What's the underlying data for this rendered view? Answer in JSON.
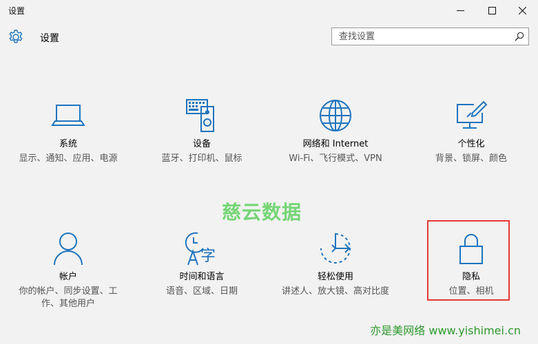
{
  "window": {
    "title": "设置"
  },
  "header": {
    "title": "设置"
  },
  "search": {
    "placeholder": "查找设置"
  },
  "tiles": [
    {
      "name": "系统",
      "desc": "显示、通知、应用、电源",
      "icon": "laptop-icon"
    },
    {
      "name": "设备",
      "desc": "蓝牙、打印机、鼠标",
      "icon": "keyboard-speaker-icon"
    },
    {
      "name": "网络和 Internet",
      "desc": "Wi-Fi、飞行模式、VPN",
      "icon": "globe-icon"
    },
    {
      "name": "个性化",
      "desc": "背景、锁屏、颜色",
      "icon": "paint-monitor-icon"
    },
    {
      "name": "帐户",
      "desc": "你的帐户、同步设置、工作、其他用户",
      "icon": "person-icon"
    },
    {
      "name": "时间和语言",
      "desc": "语音、区域、日期",
      "icon": "time-language-icon"
    },
    {
      "name": "轻松使用",
      "desc": "讲述人、放大镜、高对比度",
      "icon": "ease-of-access-icon"
    },
    {
      "name": "隐私",
      "desc": "位置、相机",
      "icon": "lock-icon"
    }
  ],
  "watermark": {
    "center": "慈云数据",
    "bottom": "亦是美网络 www.yishimei.cn"
  },
  "colors": {
    "accent": "#1e73be",
    "highlight": "#e53935",
    "watermark_green": "#5fd15f"
  }
}
